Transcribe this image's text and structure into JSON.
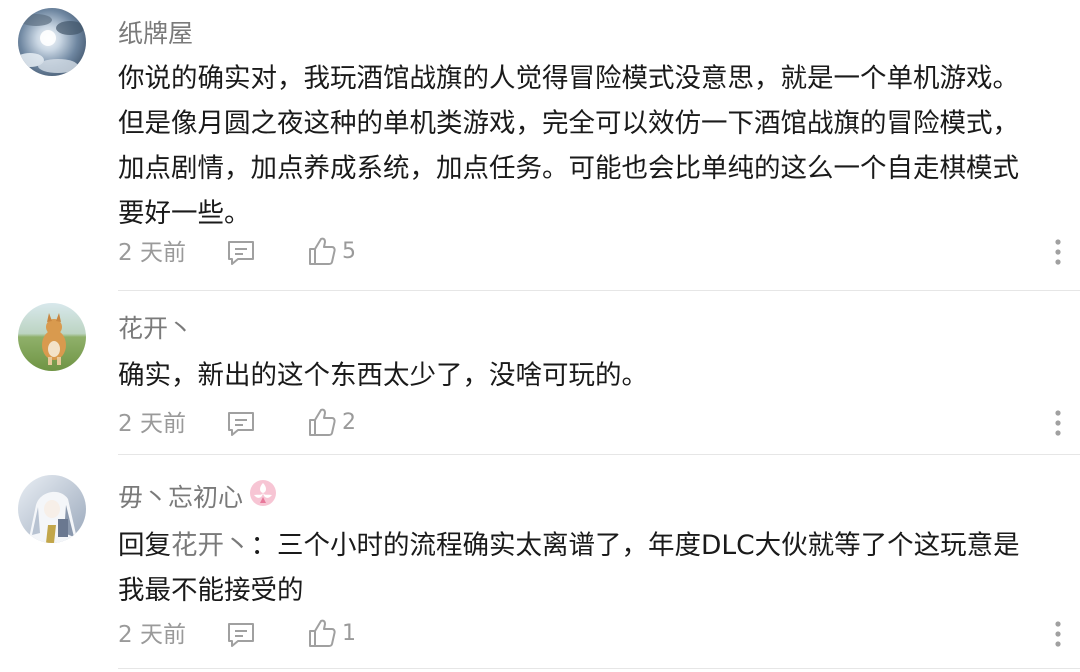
{
  "comments": [
    {
      "username": "纸牌屋",
      "avatar": "sky-clouds-avatar",
      "lines": [
        "你说的确实对，我玩酒馆战旗的人觉得冒险模式没意思，就是一个单机游戏。",
        "但是像月圆之夜这种的单机类游戏，完全可以效仿一下酒馆战旗的冒险模式，",
        "加点剧情，加点养成系统，加点任务。可能也会比单纯的这么一个自走棋模式",
        "要好一些。"
      ],
      "time": "2 天前",
      "likes": "5"
    },
    {
      "username": "花开丶",
      "avatar": "corgi-dog-avatar",
      "lines": [
        "确实，新出的这个东西太少了，没啥可玩的。"
      ],
      "time": "2 天前",
      "likes": "2"
    },
    {
      "username": "毋丶忘初心",
      "avatar": "anime-character-avatar",
      "badge": "pink-badge-icon",
      "reply_prefix": "回复",
      "reply_to": "花开丶",
      "reply_line1": "：三个小时的流程确实太离谱了，年度DLC大伙就等了个这玩意是",
      "reply_line2": "我最不能接受的",
      "time": "2 天前",
      "likes": "1"
    }
  ],
  "colors": {
    "text": "#1a1a1a",
    "secondary": "#7a7a7a",
    "meta": "#9a9a9a",
    "divider": "#e6e6e6",
    "badge": "#f0a0b8"
  }
}
